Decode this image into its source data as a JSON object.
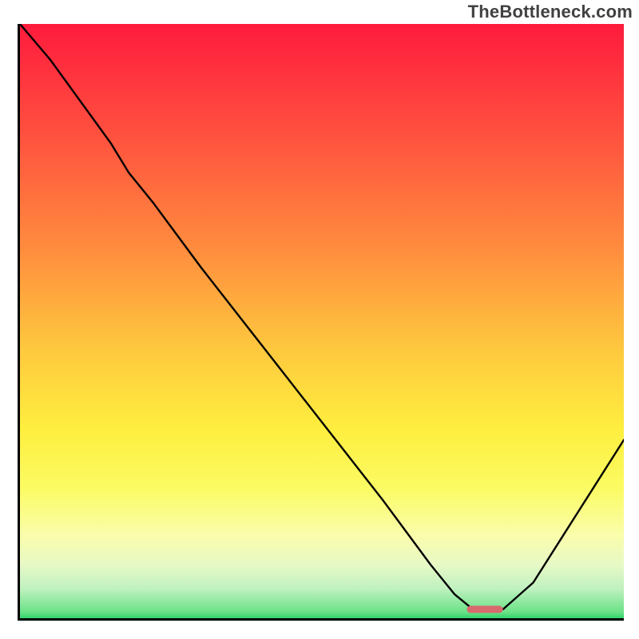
{
  "watermark": "TheBottleneck.com",
  "colors": {
    "curve": "#000000",
    "marker": "#d86a6e",
    "axis": "#000000"
  },
  "chart_data": {
    "type": "line",
    "title": "",
    "xlabel": "",
    "ylabel": "",
    "xlim": [
      0,
      100
    ],
    "ylim": [
      0,
      100
    ],
    "grid": false,
    "legend": false,
    "series": [
      {
        "name": "bottleneck-curve",
        "x": [
          0,
          5,
          10,
          15,
          18,
          22,
          30,
          40,
          50,
          60,
          68,
          72,
          75,
          78,
          80,
          85,
          90,
          95,
          100
        ],
        "y": [
          100,
          94,
          87,
          80,
          75,
          70,
          59,
          46,
          33,
          20,
          9,
          4,
          1.5,
          1.5,
          1.5,
          6,
          14,
          22,
          30
        ]
      }
    ],
    "marker": {
      "name": "optimal-range",
      "x_start": 74,
      "x_end": 80,
      "y": 1.5,
      "height": 1.2
    },
    "background_gradient": [
      {
        "stop": 0.0,
        "color": "#fe1b3d"
      },
      {
        "stop": 0.18,
        "color": "#ff4f3f"
      },
      {
        "stop": 0.38,
        "color": "#ff8d3e"
      },
      {
        "stop": 0.55,
        "color": "#fec93e"
      },
      {
        "stop": 0.68,
        "color": "#feee3e"
      },
      {
        "stop": 0.78,
        "color": "#fbfb63"
      },
      {
        "stop": 0.86,
        "color": "#fafdab"
      },
      {
        "stop": 0.91,
        "color": "#e7f9c6"
      },
      {
        "stop": 0.95,
        "color": "#c0f1c0"
      },
      {
        "stop": 0.99,
        "color": "#69e287"
      },
      {
        "stop": 1.0,
        "color": "#30d36d"
      }
    ]
  }
}
